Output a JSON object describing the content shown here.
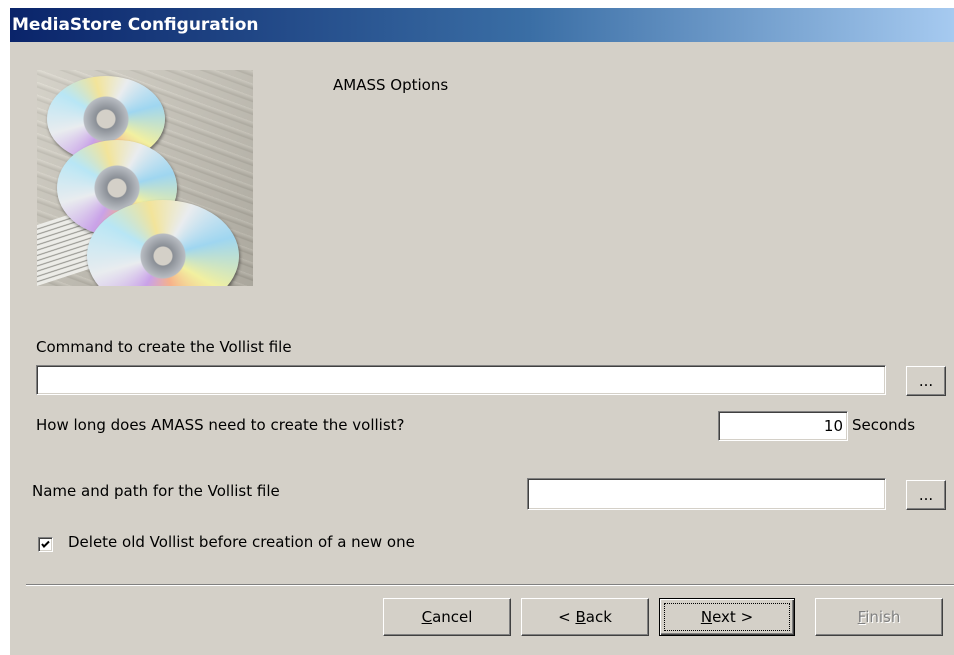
{
  "window": {
    "title": "MediaStore Configuration"
  },
  "page": {
    "heading": "AMASS Options"
  },
  "command": {
    "label": "Command to create the Vollist file",
    "value": "",
    "browse_label": "..."
  },
  "duration": {
    "label": "How long does AMASS need to create the vollist?",
    "value": "10",
    "unit": "Seconds"
  },
  "vollist_path": {
    "label": "Name and path for the Vollist file",
    "value": "",
    "browse_label": "..."
  },
  "delete_old": {
    "label": "Delete old Vollist before creation of a new one",
    "checked": true
  },
  "buttons": {
    "cancel": {
      "mnemonic": "C",
      "rest": "ancel"
    },
    "back": {
      "prefix": "< ",
      "mnemonic": "B",
      "rest": "ack"
    },
    "next": {
      "mnemonic": "N",
      "rest": "ext >"
    },
    "finish": {
      "mnemonic": "F",
      "rest": "inish",
      "enabled": false
    }
  },
  "colors": {
    "dialog_background": "#d4d0c8",
    "titlebar_start": "#0a246a",
    "titlebar_end": "#a6caf0"
  }
}
